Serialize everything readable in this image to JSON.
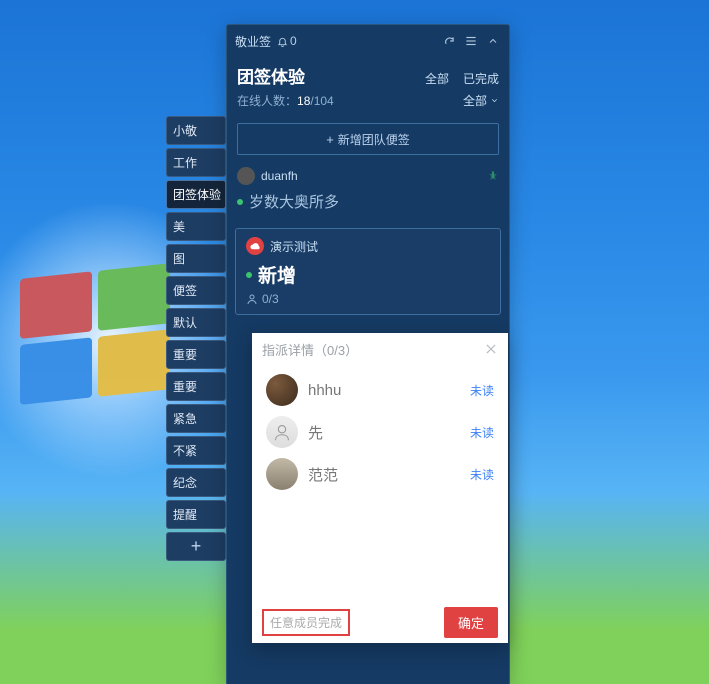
{
  "titlebar": {
    "app_name": "敬业签",
    "notif_count": "0"
  },
  "header": {
    "title": "团签体验",
    "tab_all": "全部",
    "tab_done": "已完成",
    "online_label": "在线人数：",
    "online_current": "18",
    "online_total": "/104",
    "filter_label": "全部"
  },
  "add_note_label": "新增团队便签",
  "side_tabs": [
    "小敬",
    "工作",
    "团签体验",
    "美",
    "图",
    "便签",
    "默认",
    "重要",
    "重要",
    "紧急",
    "不紧",
    "纪念",
    "提醒"
  ],
  "notes": [
    {
      "owner": "duanfh",
      "text": "岁数大奥所多",
      "pinned": true
    }
  ],
  "card": {
    "owner_name": "演示测试",
    "title": "新增",
    "assign_count": "0/3"
  },
  "popup": {
    "title": "指派详情（0/3）",
    "members": [
      {
        "name": "hhhu",
        "status": "未读"
      },
      {
        "name": "先",
        "status": "未读"
      },
      {
        "name": "范范",
        "status": "未读"
      }
    ],
    "footer_left": "任意成员完成",
    "confirm": "确定"
  }
}
